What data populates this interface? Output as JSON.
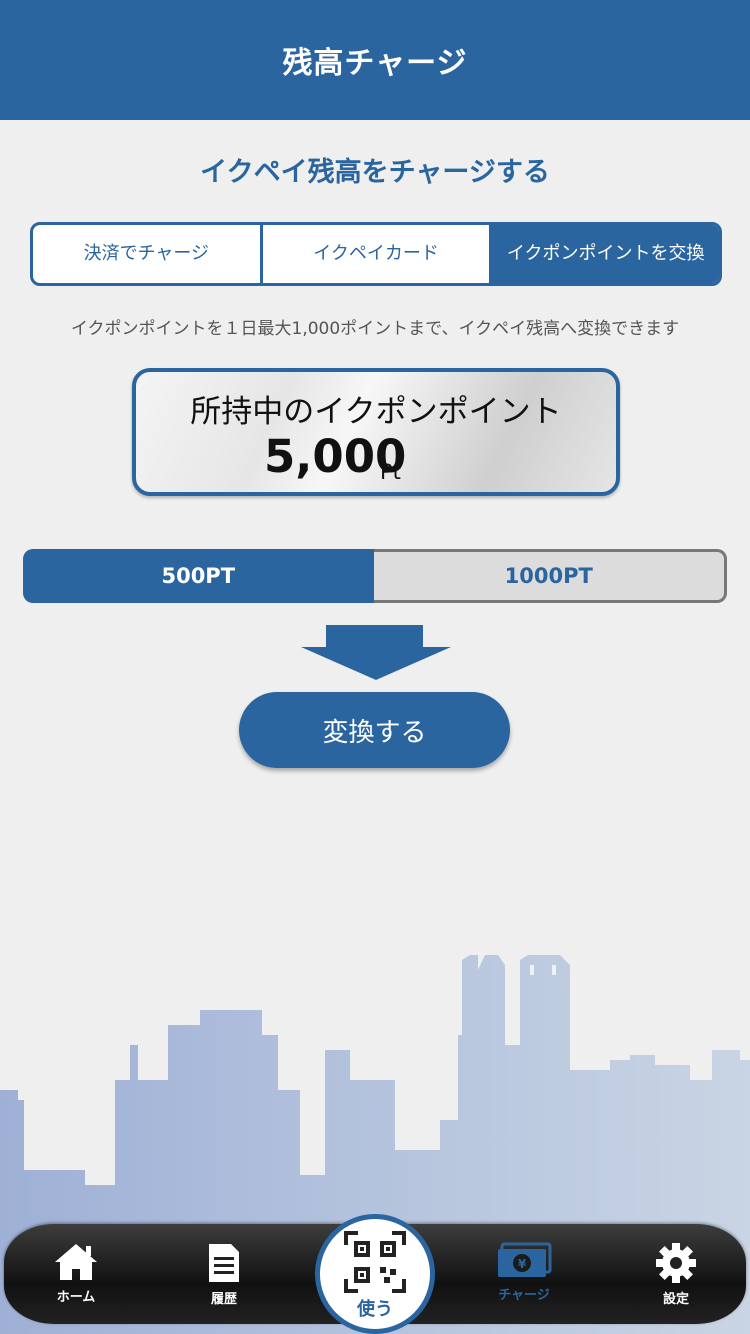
{
  "header": {
    "title": "残高チャージ"
  },
  "subtitle": "イクペイ残高をチャージする",
  "tabs": [
    {
      "label": "決済でチャージ"
    },
    {
      "label": "イクペイカード"
    },
    {
      "label": "イクポンポイントを交換"
    }
  ],
  "notice": "イクポンポイントを１日最大1,000ポイントまで、イクペイ残高へ変換できます",
  "points": {
    "label": "所持中のイクポンポイント",
    "value": "5,000",
    "unit": "Pt"
  },
  "amount_options": [
    {
      "label": "500PT",
      "selected": true
    },
    {
      "label": "1000PT",
      "selected": false
    }
  ],
  "convert_button": "変換する",
  "bottom_nav": {
    "home": "ホーム",
    "history": "履歴",
    "use": "使う",
    "charge": "チャージ",
    "settings": "設定"
  },
  "colors": {
    "primary": "#2a659f",
    "background": "#efefef",
    "nav_bar": "#1a1a1a"
  }
}
